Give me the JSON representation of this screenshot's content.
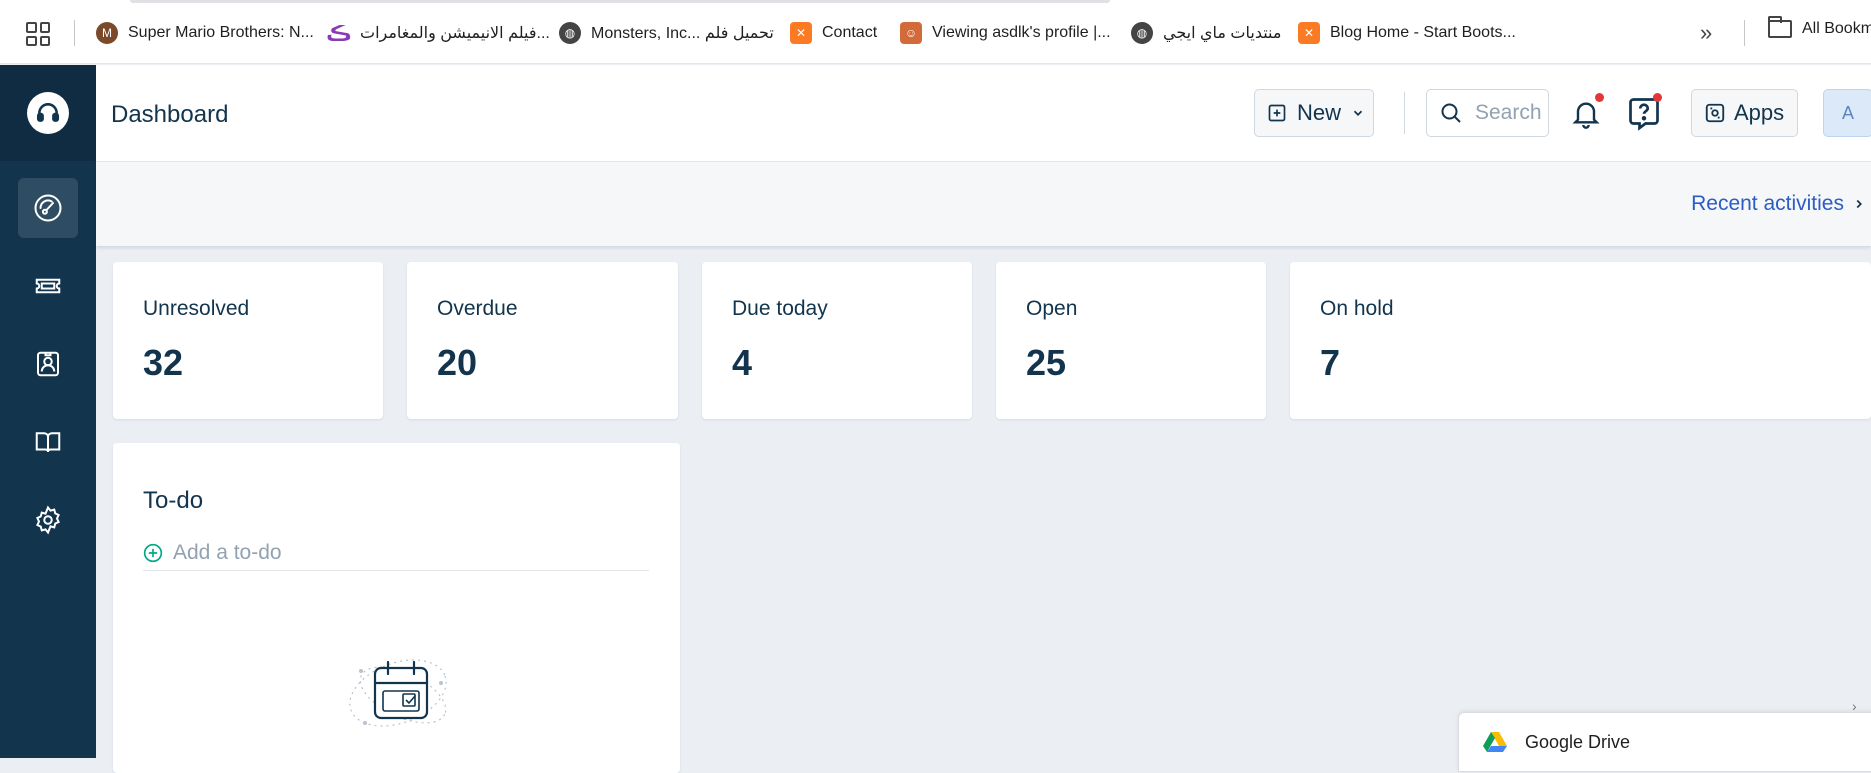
{
  "bookmarks": {
    "items": [
      {
        "label": "Super Mario Brothers: N...",
        "icon": "mario-icon"
      },
      {
        "label": "فيلم الانيميشن والمغامرات...",
        "icon": "swirl-icon"
      },
      {
        "label": "Monsters, Inc... تحميل فلم",
        "icon": "globe-icon"
      },
      {
        "label": "Contact",
        "icon": "xampp-icon"
      },
      {
        "label": "Viewing asdlk's profile |...",
        "icon": "face-icon"
      },
      {
        "label": "منتديات ماي ايجي",
        "icon": "globe-icon"
      },
      {
        "label": "Blog Home - Start Boots...",
        "icon": "xampp-icon"
      }
    ],
    "more": "»",
    "all_bookmarks": "All Bookm"
  },
  "sidebar": {
    "items": [
      {
        "name": "dashboard",
        "icon": "gauge-icon",
        "active": true
      },
      {
        "name": "tickets",
        "icon": "ticket-icon"
      },
      {
        "name": "contacts",
        "icon": "contact-card-icon"
      },
      {
        "name": "solutions",
        "icon": "book-icon"
      },
      {
        "name": "admin",
        "icon": "gear-icon"
      }
    ]
  },
  "header": {
    "title": "Dashboard",
    "new_label": "New",
    "search_placeholder": "Search",
    "apps_label": "Apps",
    "avatar_initial": "A"
  },
  "strip": {
    "recent_label": "Recent activities"
  },
  "cards": [
    {
      "label": "Unresolved",
      "value": "32"
    },
    {
      "label": "Overdue",
      "value": "20"
    },
    {
      "label": "Due today",
      "value": "4"
    },
    {
      "label": "Open",
      "value": "25"
    },
    {
      "label": "On hold",
      "value": "7"
    }
  ],
  "todo": {
    "title": "To-do",
    "add_placeholder": "Add a to-do"
  },
  "gdrive": {
    "label": "Google Drive"
  },
  "colors": {
    "sidebar": "#12344d",
    "link": "#2c5cc5",
    "notification_dot": "#e43538",
    "add_icon": "#00a886"
  }
}
